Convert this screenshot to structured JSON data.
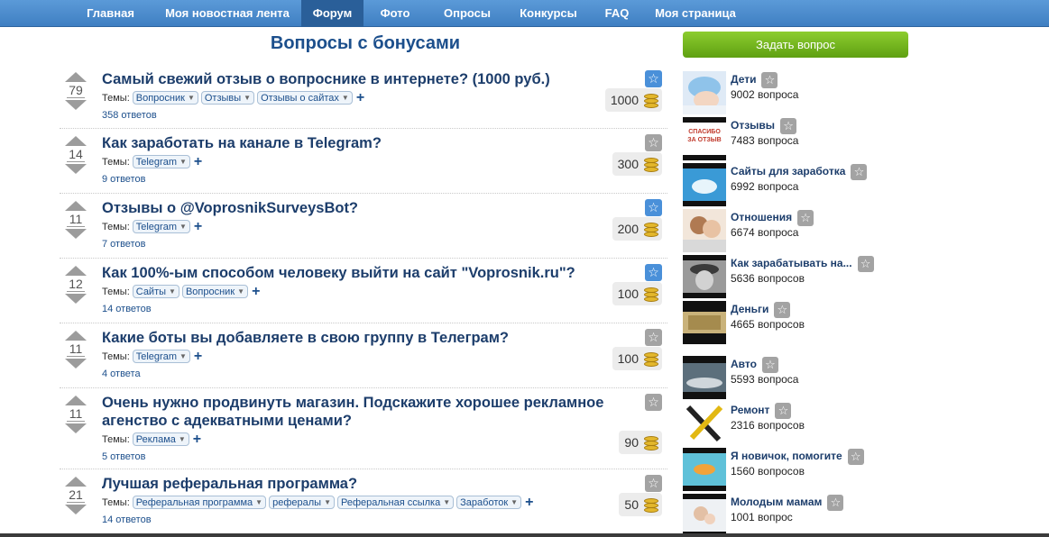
{
  "nav": {
    "items": [
      {
        "label": "Главная"
      },
      {
        "label": "Моя новостная лента"
      },
      {
        "label": "Форум"
      },
      {
        "label": "Фото"
      },
      {
        "label": "Опросы"
      },
      {
        "label": "Конкурсы"
      },
      {
        "label": "FAQ"
      },
      {
        "label": "Моя страница"
      }
    ],
    "active": "Форум"
  },
  "page_title": "Вопросы с бонусами",
  "tags_label": "Темы:",
  "questions": [
    {
      "votes": "79",
      "title": "Самый свежий отзыв о вопроснике в интернете? (1000 руб.)",
      "tags": [
        "Вопросник",
        "Отзывы",
        "Отзывы о сайтах"
      ],
      "answers": "358 ответов",
      "bonus": "1000",
      "star": "blue"
    },
    {
      "votes": "14",
      "title": "Как заработать на канале в Telegram?",
      "tags": [
        "Telegram"
      ],
      "answers": "9 ответов",
      "bonus": "300",
      "star": "gray"
    },
    {
      "votes": "11",
      "title": "Отзывы о @VoprosnikSurveysBot?",
      "tags": [
        "Telegram"
      ],
      "answers": "7 ответов",
      "bonus": "200",
      "star": "blue"
    },
    {
      "votes": "12",
      "title": "Как 100%-ым способом человеку выйти на сайт \"Voprosnik.ru\"?",
      "tags": [
        "Сайты",
        "Вопросник"
      ],
      "answers": "14 ответов",
      "bonus": "100",
      "star": "blue"
    },
    {
      "votes": "11",
      "title": "Какие боты вы добавляете в свою группу в Телеграм?",
      "tags": [
        "Telegram"
      ],
      "answers": "4 ответа",
      "bonus": "100",
      "star": "gray"
    },
    {
      "votes": "11",
      "title": "Очень нужно продвинуть магазин. Подскажите хорошее рекламное агенство с адекватными ценами?",
      "tags": [
        "Реклама"
      ],
      "answers": "5 ответов",
      "bonus": "90",
      "star": "gray"
    },
    {
      "votes": "21",
      "title": "Лучшая реферальная программа?",
      "tags": [
        "Реферальная программа",
        "рефералы",
        "Реферальная ссылка",
        "Заработок"
      ],
      "answers": "14 ответов",
      "bonus": "50",
      "star": "gray"
    }
  ],
  "sidebar": {
    "ask_button": "Задать вопрос",
    "categories": [
      {
        "name": "Дети",
        "count": "9002 вопроса",
        "thumb": "baby"
      },
      {
        "name": "Отзывы",
        "count": "7483 вопроса",
        "thumb": "spasibo"
      },
      {
        "name": "Сайты для заработка",
        "count": "6992 вопроса",
        "thumb": "web"
      },
      {
        "name": "Отношения",
        "count": "6674 вопроса",
        "thumb": "couple"
      },
      {
        "name": "Как зарабатывать на...",
        "count": "5636 вопросов",
        "thumb": "man"
      },
      {
        "name": "Деньги",
        "count": "4665 вопросов",
        "thumb": "banknote"
      },
      {
        "name": "Авто",
        "count": "5593 вопроса",
        "thumb": "car"
      },
      {
        "name": "Ремонт",
        "count": "2316 вопросов",
        "thumb": "tools"
      },
      {
        "name": "Я новичок, помогите",
        "count": "1560 вопросов",
        "thumb": "fish"
      },
      {
        "name": "Молодым мамам",
        "count": "1001 вопрос",
        "thumb": "mom"
      }
    ],
    "thumb_labels": {
      "spasibo": "СПАСИБО ЗА ОТЗЫВ"
    }
  },
  "colors": {
    "nav_bg": "#4a8ccf",
    "nav_active": "#2a5f99",
    "ask_button": "#73b521",
    "title": "#1c3d6b",
    "star_blue": "#4a90d9",
    "star_gray": "#a3a3a3"
  }
}
